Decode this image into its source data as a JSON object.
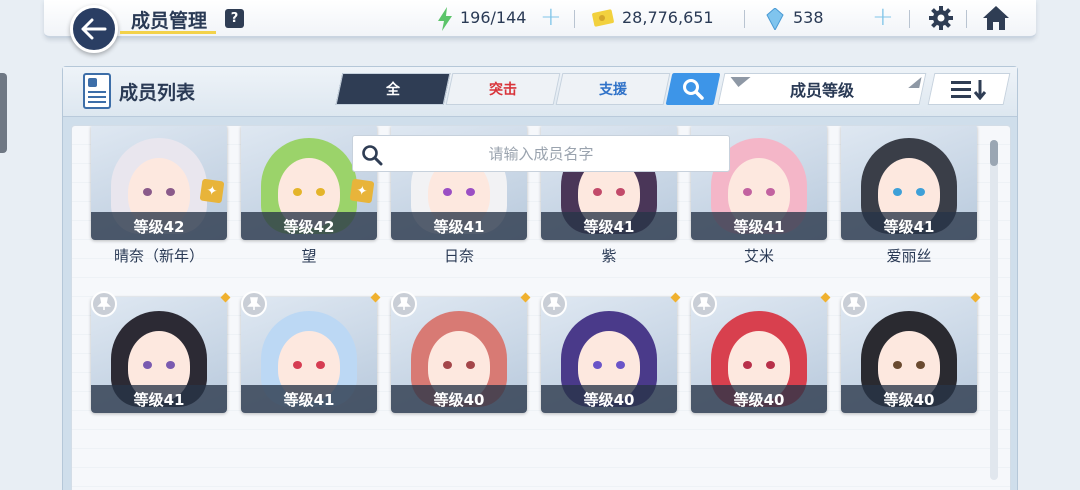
{
  "header": {
    "title": "成员管理",
    "help": "?",
    "stamina": "196/144",
    "credits": "28,776,651",
    "gems": "538",
    "stamina_plus": "+",
    "gems_plus": "+"
  },
  "panel": {
    "title": "成员列表",
    "tabs": [
      {
        "label": "全",
        "active": true
      },
      {
        "label": "突击",
        "active": false
      },
      {
        "label": "支援",
        "active": false
      }
    ],
    "sort_label": "成员等级",
    "search_placeholder": "请输入成员名字"
  },
  "members_row1": [
    {
      "level": "等级42",
      "name": "晴奈（新年）",
      "hair": "#e9e6ee",
      "eye": "#8a5a8a",
      "badge": true
    },
    {
      "level": "等级42",
      "name": "望",
      "hair": "#9bd36a",
      "eye": "#e4b42a",
      "badge": true
    },
    {
      "level": "等级41",
      "name": "日奈",
      "hair": "#f2f2f4",
      "eye": "#9b4fc4",
      "badge": false
    },
    {
      "level": "等级41",
      "name": "紫",
      "hair": "#4a3658",
      "eye": "#c24a6a",
      "badge": false
    },
    {
      "level": "等级41",
      "name": "艾米",
      "hair": "#f4b6c8",
      "eye": "#c262a0",
      "badge": false
    },
    {
      "level": "等级41",
      "name": "爱丽丝",
      "hair": "#3a3e48",
      "eye": "#3ea0d8",
      "badge": false
    }
  ],
  "members_row2": [
    {
      "level": "等级41",
      "hair": "#2c2a34",
      "eye": "#7a5ab0"
    },
    {
      "level": "等级41",
      "hair": "#bcd8f4",
      "eye": "#d63c52"
    },
    {
      "level": "等级40",
      "hair": "#d87a74",
      "eye": "#a4464a"
    },
    {
      "level": "等级40",
      "hair": "#4a3a8a",
      "eye": "#6a54c8"
    },
    {
      "level": "等级40",
      "hair": "#d8404e",
      "eye": "#b8304a"
    },
    {
      "level": "等级40",
      "hair": "#2a2a30",
      "eye": "#6a4a30"
    }
  ],
  "colors": {
    "dark_navy": "#2f3d54",
    "accent_blue": "#3d95e8",
    "assault_red": "#d8343a",
    "support_blue": "#2f72c8",
    "title_underline": "#f2d24b"
  },
  "icons": [
    "back-arrow-icon",
    "help-icon",
    "stamina-icon",
    "credit-icon",
    "gem-icon",
    "settings-gear-icon",
    "home-icon",
    "member-list-icon",
    "search-icon",
    "sort-order-icon",
    "pin-icon",
    "star-badge-icon"
  ]
}
